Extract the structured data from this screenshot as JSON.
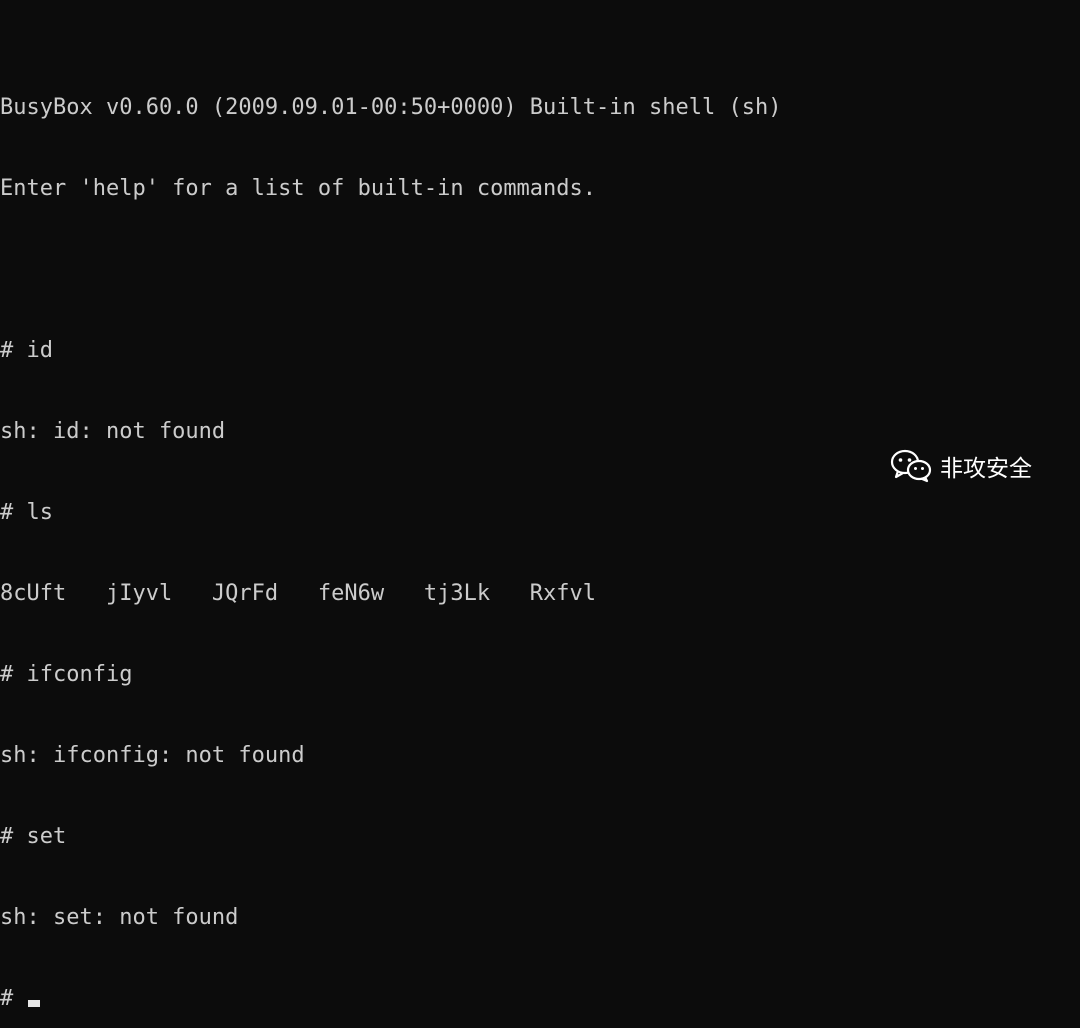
{
  "terminal": {
    "lines": [
      "BusyBox v0.60.0 (2009.09.01-00:50+0000) Built-in shell (sh)",
      "Enter 'help' for a list of built-in commands.",
      "",
      "# id",
      "sh: id: not found",
      "# ls",
      "8cUft   jIyvl   JQrFd   feN6w   tj3Lk   Rxfvl",
      "# ifconfig",
      "sh: ifconfig: not found",
      "# set",
      "sh: set: not found"
    ],
    "prompt": "# "
  },
  "watermark": {
    "icon": "wechat-icon",
    "text": "非攻安全"
  }
}
